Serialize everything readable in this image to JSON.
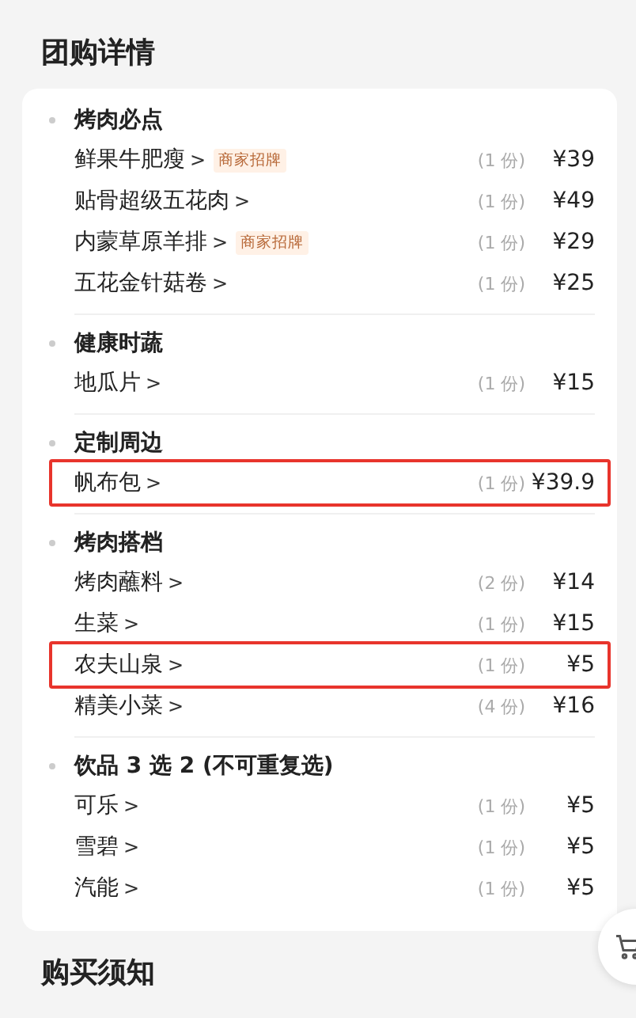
{
  "title": "团购详情",
  "groups": [
    {
      "title": "烤肉必点",
      "items": [
        {
          "name": "鲜果牛肥瘦",
          "chevron": ">",
          "tag": "商家招牌",
          "qty": "(1 份)",
          "price": "¥39",
          "highlighted": false
        },
        {
          "name": "贴骨超级五花肉",
          "chevron": ">",
          "qty": "(1 份)",
          "price": "¥49",
          "highlighted": false
        },
        {
          "name": "内蒙草原羊排",
          "chevron": ">",
          "tag": "商家招牌",
          "qty": "(1 份)",
          "price": "¥29",
          "highlighted": false
        },
        {
          "name": "五花金针菇卷",
          "chevron": ">",
          "qty": "(1 份)",
          "price": "¥25",
          "highlighted": false
        }
      ]
    },
    {
      "title": "健康时蔬",
      "items": [
        {
          "name": "地瓜片",
          "chevron": ">",
          "qty": "(1 份)",
          "price": "¥15",
          "highlighted": false
        }
      ]
    },
    {
      "title": "定制周边",
      "items": [
        {
          "name": "帆布包",
          "chevron": ">",
          "qty": "(1 份)",
          "price": "¥39.9",
          "highlighted": true
        }
      ]
    },
    {
      "title": "烤肉搭档",
      "items": [
        {
          "name": "烤肉蘸料",
          "chevron": ">",
          "qty": "(2 份)",
          "price": "¥14",
          "highlighted": false
        },
        {
          "name": "生菜",
          "chevron": ">",
          "qty": "(1 份)",
          "price": "¥15",
          "highlighted": false
        },
        {
          "name": "农夫山泉",
          "chevron": ">",
          "qty": "(1 份)",
          "price": "¥5",
          "highlighted": true
        },
        {
          "name": "精美小菜",
          "chevron": ">",
          "qty": "(4 份)",
          "price": "¥16",
          "highlighted": false
        }
      ]
    },
    {
      "title": "饮品 3 选 2 (不可重复选)",
      "items": [
        {
          "name": "可乐",
          "chevron": ">",
          "qty": "(1 份)",
          "price": "¥5",
          "highlighted": false
        },
        {
          "name": "雪碧",
          "chevron": ">",
          "qty": "(1 份)",
          "price": "¥5",
          "highlighted": false
        },
        {
          "name": "汽能",
          "chevron": ">",
          "qty": "(1 份)",
          "price": "¥5",
          "highlighted": false
        }
      ]
    }
  ],
  "notice_title": "购买须知"
}
